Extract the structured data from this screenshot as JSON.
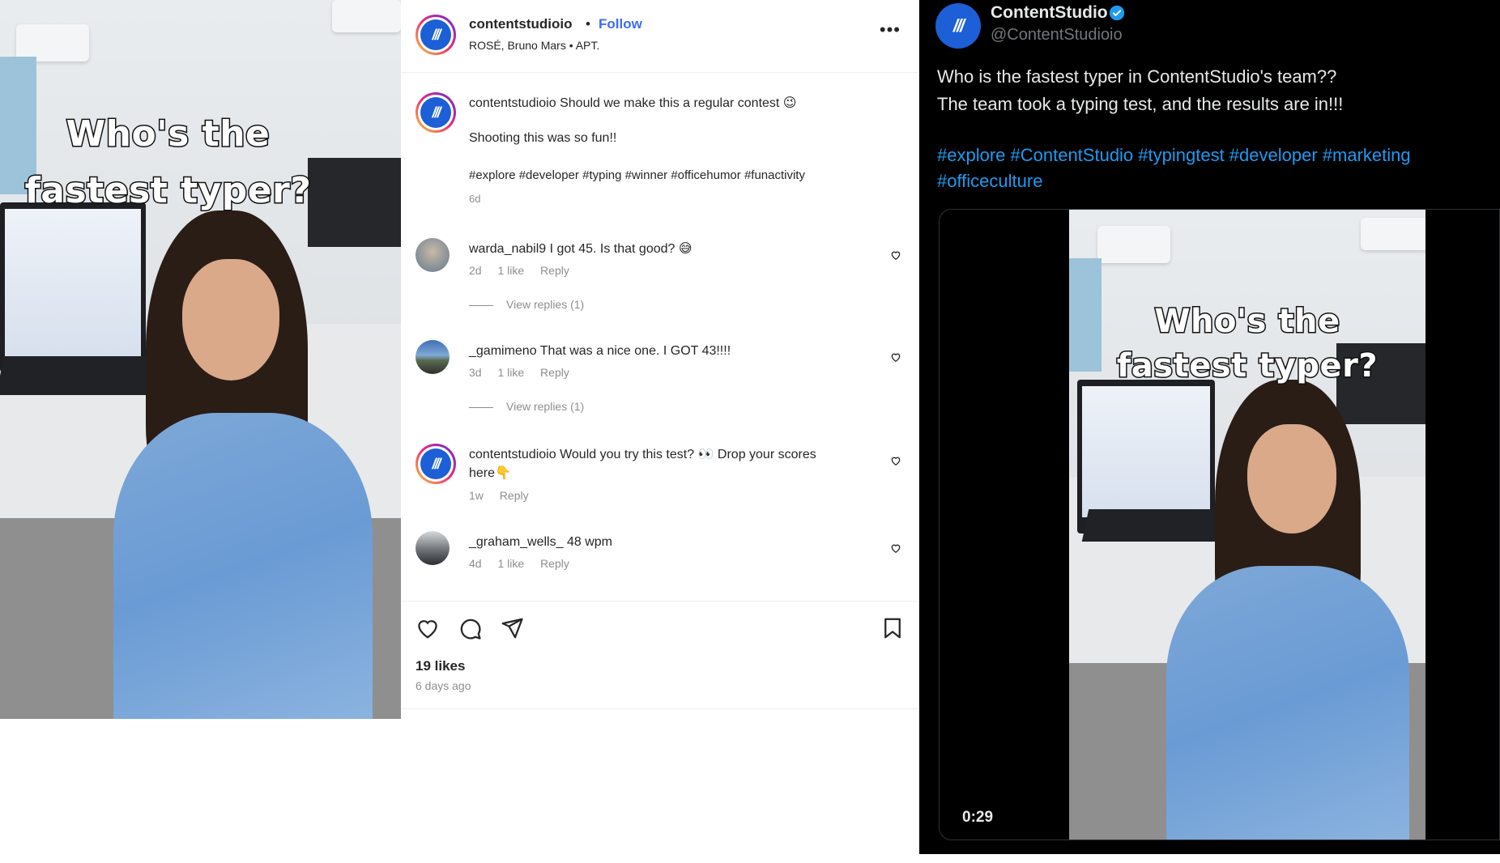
{
  "instagram": {
    "overlay_line1": "Who's the",
    "overlay_line2": "fastest typer?",
    "header": {
      "username": "contentstudioio",
      "separator": "•",
      "follow": "Follow",
      "audio": "ROSÉ, Bruno Mars • APT.",
      "more": "•••"
    },
    "caption": {
      "username": "contentstudioio",
      "text": "Should we make this a regular contest 😉",
      "line2": "Shooting this was so fun!!",
      "hashtags": "#explore #developer #typing #winner #officehumor #funactivity",
      "time": "6d"
    },
    "comments": [
      {
        "username": "warda_nabil9",
        "text": "I got 45. Is that good? 😅",
        "time": "2d",
        "likes": "1 like",
        "reply": "Reply",
        "view_replies": "View replies (1)"
      },
      {
        "username": "_gamimeno",
        "text": "That was a nice one. I GOT 43!!!!",
        "time": "3d",
        "likes": "1 like",
        "reply": "Reply",
        "view_replies": "View replies (1)"
      },
      {
        "username": "contentstudioio",
        "text": "Would you try this test? 👀 Drop your scores here👇",
        "time": "1w",
        "reply": "Reply"
      },
      {
        "username": "_graham_wells_",
        "text": "48 wpm",
        "time": "4d",
        "likes": "1 like",
        "reply": "Reply"
      }
    ],
    "likes": "19 likes",
    "posted": "6 days ago"
  },
  "twitter": {
    "name": "ContentStudio",
    "handle": "@ContentStudioio",
    "text_line1": "Who is the fastest typer in ContentStudio's team??",
    "text_line2": "The team took a typing test, and the results are in!!!",
    "hashtags": "#explore #ContentStudio #typingtest #developer #marketing #officeculture",
    "overlay_line1": "Who's the",
    "overlay_line2": "fastest typer?",
    "video_time": "0:29"
  },
  "colors": {
    "brand_blue": "#1c5fd6",
    "ig_link": "#3d6df2",
    "tw_link": "#1d9bf0",
    "tw_bg": "#000000"
  }
}
